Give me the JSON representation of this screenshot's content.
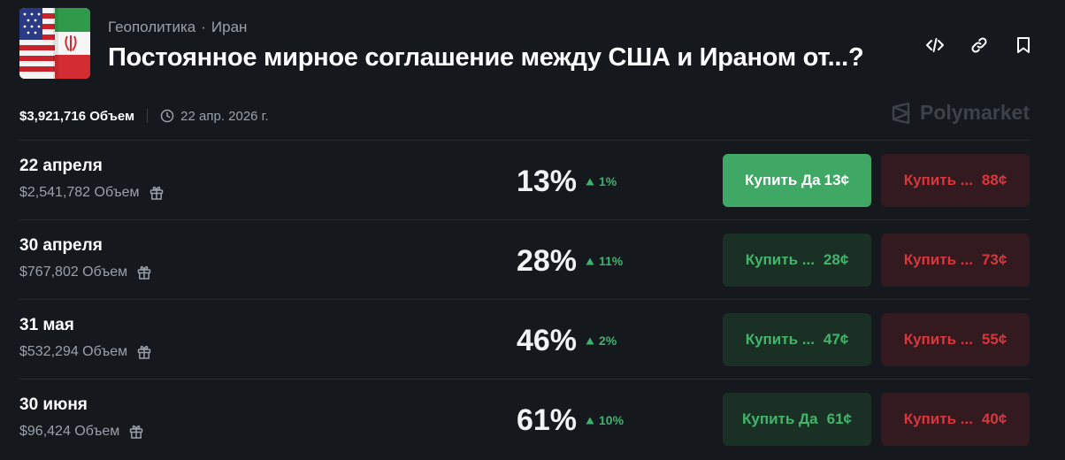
{
  "header": {
    "category": "Геополитика",
    "separator": "·",
    "tag": "Иран",
    "title": "Постоянное мирное соглашение между США и Ираном от...?",
    "icons": [
      "embed-code-icon",
      "link-icon",
      "bookmark-icon"
    ]
  },
  "meta": {
    "volume": "$3,921,716 Объем",
    "end_date": "22 апр. 2026 г.",
    "brand": "Polymarket"
  },
  "colors": {
    "background": "#15191e",
    "yes_active": "#3fa864",
    "yes": "#44b46c",
    "no": "#d8373e",
    "change_up": "#3fb26b"
  },
  "outcomes": [
    {
      "date": "22 апреля",
      "volume": "$2,541,782 Объем",
      "probability": "13%",
      "change": "1%",
      "yes_label": "Купить Да",
      "yes_price": "13¢",
      "no_label": "Купить ...",
      "no_price": "88¢"
    },
    {
      "date": "30 апреля",
      "volume": "$767,802 Объем",
      "probability": "28%",
      "change": "11%",
      "yes_label": "Купить ...",
      "yes_price": "28¢",
      "no_label": "Купить ...",
      "no_price": "73¢"
    },
    {
      "date": "31 мая",
      "volume": "$532,294 Объем",
      "probability": "46%",
      "change": "2%",
      "yes_label": "Купить ...",
      "yes_price": "47¢",
      "no_label": "Купить ...",
      "no_price": "55¢"
    },
    {
      "date": "30 июня",
      "volume": "$96,424 Объем",
      "probability": "61%",
      "change": "10%",
      "yes_label": "Купить Да",
      "yes_price": "61¢",
      "no_label": "Купить ...",
      "no_price": "40¢"
    }
  ]
}
